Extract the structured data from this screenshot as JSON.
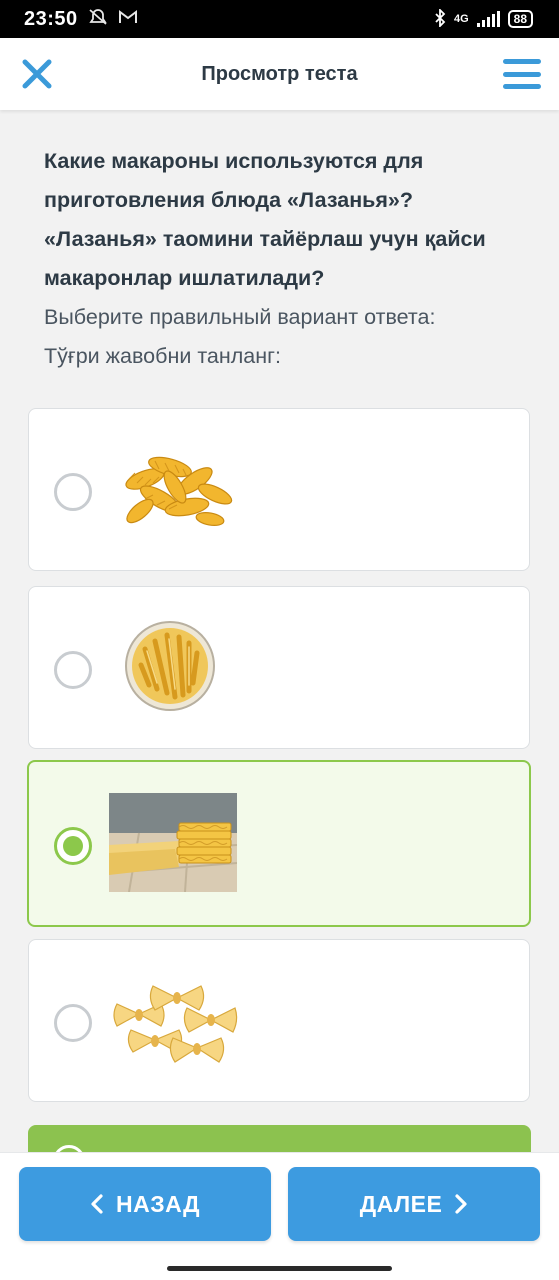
{
  "status": {
    "time": "23:50",
    "network": "4G",
    "battery": "88"
  },
  "header": {
    "title": "Просмотр теста"
  },
  "question": {
    "text_ru": "Какие макароны используются для приготовления блюда «Лазанья»?",
    "text_uz": "«Лазанья» таомини тайёрлаш учун қайси макаронлар ишлатилади?",
    "instruction_ru": "Выберите правильный вариант ответа:",
    "instruction_uz": "Тўғри жавобни танланг:"
  },
  "options": [
    {
      "image": "fusilli-pasta",
      "selected": false
    },
    {
      "image": "penne-pasta-bowl",
      "selected": false
    },
    {
      "image": "lasagna-sheets",
      "selected": true
    },
    {
      "image": "farfalle-pasta",
      "selected": false
    }
  ],
  "nav": {
    "back_label": "НАЗАД",
    "next_label": "ДАЛЕЕ"
  },
  "colors": {
    "accent_blue": "#3d9be0",
    "selected_green": "#8cc84b",
    "selected_bg": "#f3faea"
  }
}
